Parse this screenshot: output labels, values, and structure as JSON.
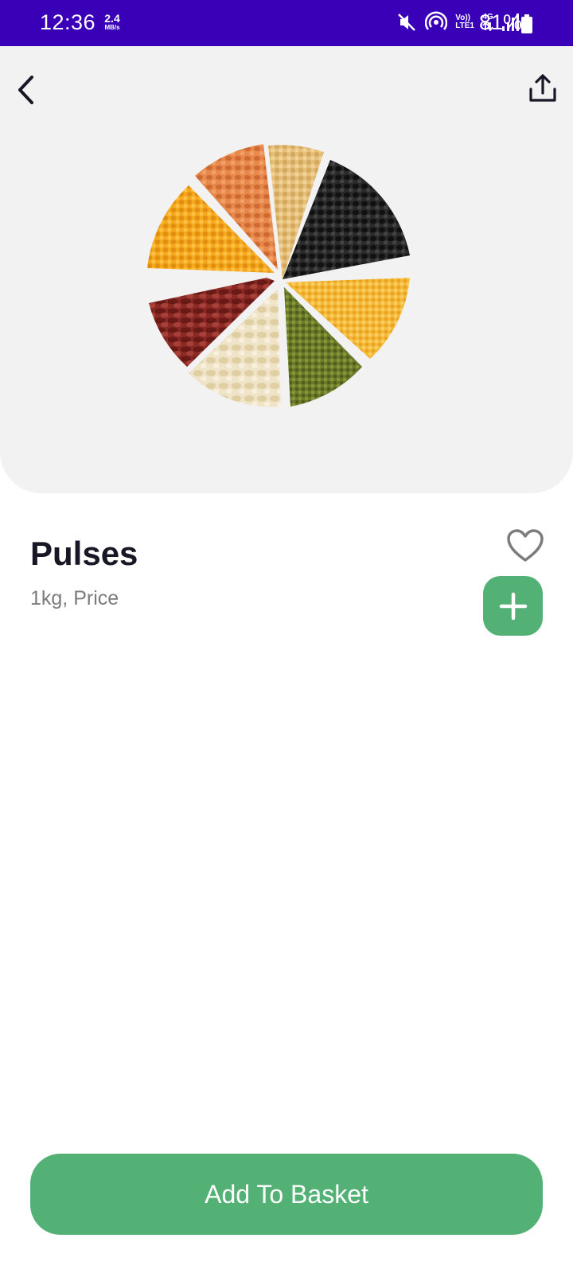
{
  "status_bar": {
    "time": "12:36",
    "speed_value": "2.4",
    "speed_unit": "MB/s",
    "volte_top": "Vo))",
    "volte_bottom": "LTE1",
    "network": "4G",
    "battery_percent": "81%",
    "icons": [
      "mute-icon",
      "hotspot-icon",
      "volte-icon",
      "data-arrows-icon",
      "signal-icon",
      "battery-icon"
    ]
  },
  "header": {
    "back_icon": "chevron-left-icon",
    "share_icon": "share-upload-icon"
  },
  "product": {
    "image_description_icon": "pulses-product-image",
    "title": "Pulses",
    "subtitle": "1kg, Price",
    "favorite_icon": "heart-outline-icon",
    "add_icon": "plus-icon"
  },
  "actions": {
    "add_to_basket_label": "Add To Basket"
  },
  "colors": {
    "status_bar": "#3a00b8",
    "hero_bg": "#f2f2f2",
    "accent_green": "#53b175",
    "title_text": "#181725",
    "subtitle_text": "#7c7c7c"
  }
}
